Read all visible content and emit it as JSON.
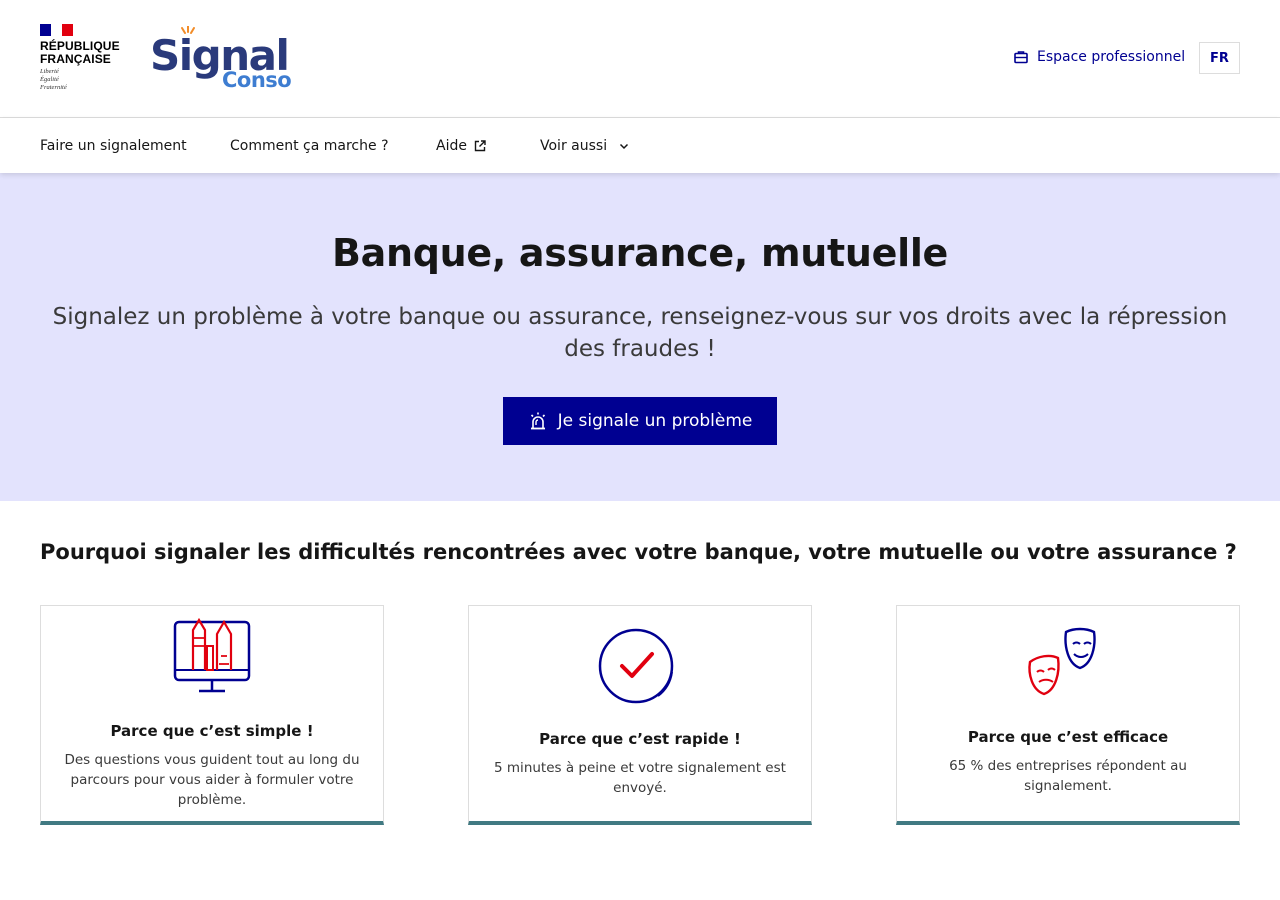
{
  "header": {
    "rf_line1": "RÉPUBLIQUE",
    "rf_line2": "FRANÇAISE",
    "devise": [
      "Liberté",
      "Égalité",
      "Fraternité"
    ],
    "logo_main": "Signal",
    "logo_sub": "Conso",
    "pro_link": "Espace professionnel",
    "lang": "FR"
  },
  "nav": {
    "items": [
      {
        "label": "Faire un signalement"
      },
      {
        "label": "Comment ça marche ?"
      },
      {
        "label": "Aide"
      },
      {
        "label": "Voir aussi"
      }
    ]
  },
  "hero": {
    "title": "Banque, assurance, mutuelle",
    "subtitle": "Signalez un problème à votre banque ou assurance, renseignez-vous sur vos droits avec la répression des fraudes !",
    "cta": "Je signale un problème"
  },
  "section": {
    "title": "Pourquoi signaler les difficultés rencontrées avec votre banque, votre mutuelle ou votre assurance ?"
  },
  "cards": [
    {
      "title": "Parce que c’est simple !",
      "text": "Des questions vous guident tout au long du parcours pour vous aider à formuler votre problème.",
      "icon": "computer-icon"
    },
    {
      "title": "Parce que c’est rapide !",
      "text": "5 minutes à peine et votre signalement est envoyé.",
      "icon": "checkmark-icon"
    },
    {
      "title": "Parce que c’est efficace",
      "text": "65 % des entreprises répondent au signalement.",
      "icon": "theater-masks-icon"
    }
  ],
  "colors": {
    "brand_blue": "#000091",
    "hero_bg": "#e3e3fd",
    "card_accent": "#417a82",
    "marianne_red": "#e1000f"
  }
}
